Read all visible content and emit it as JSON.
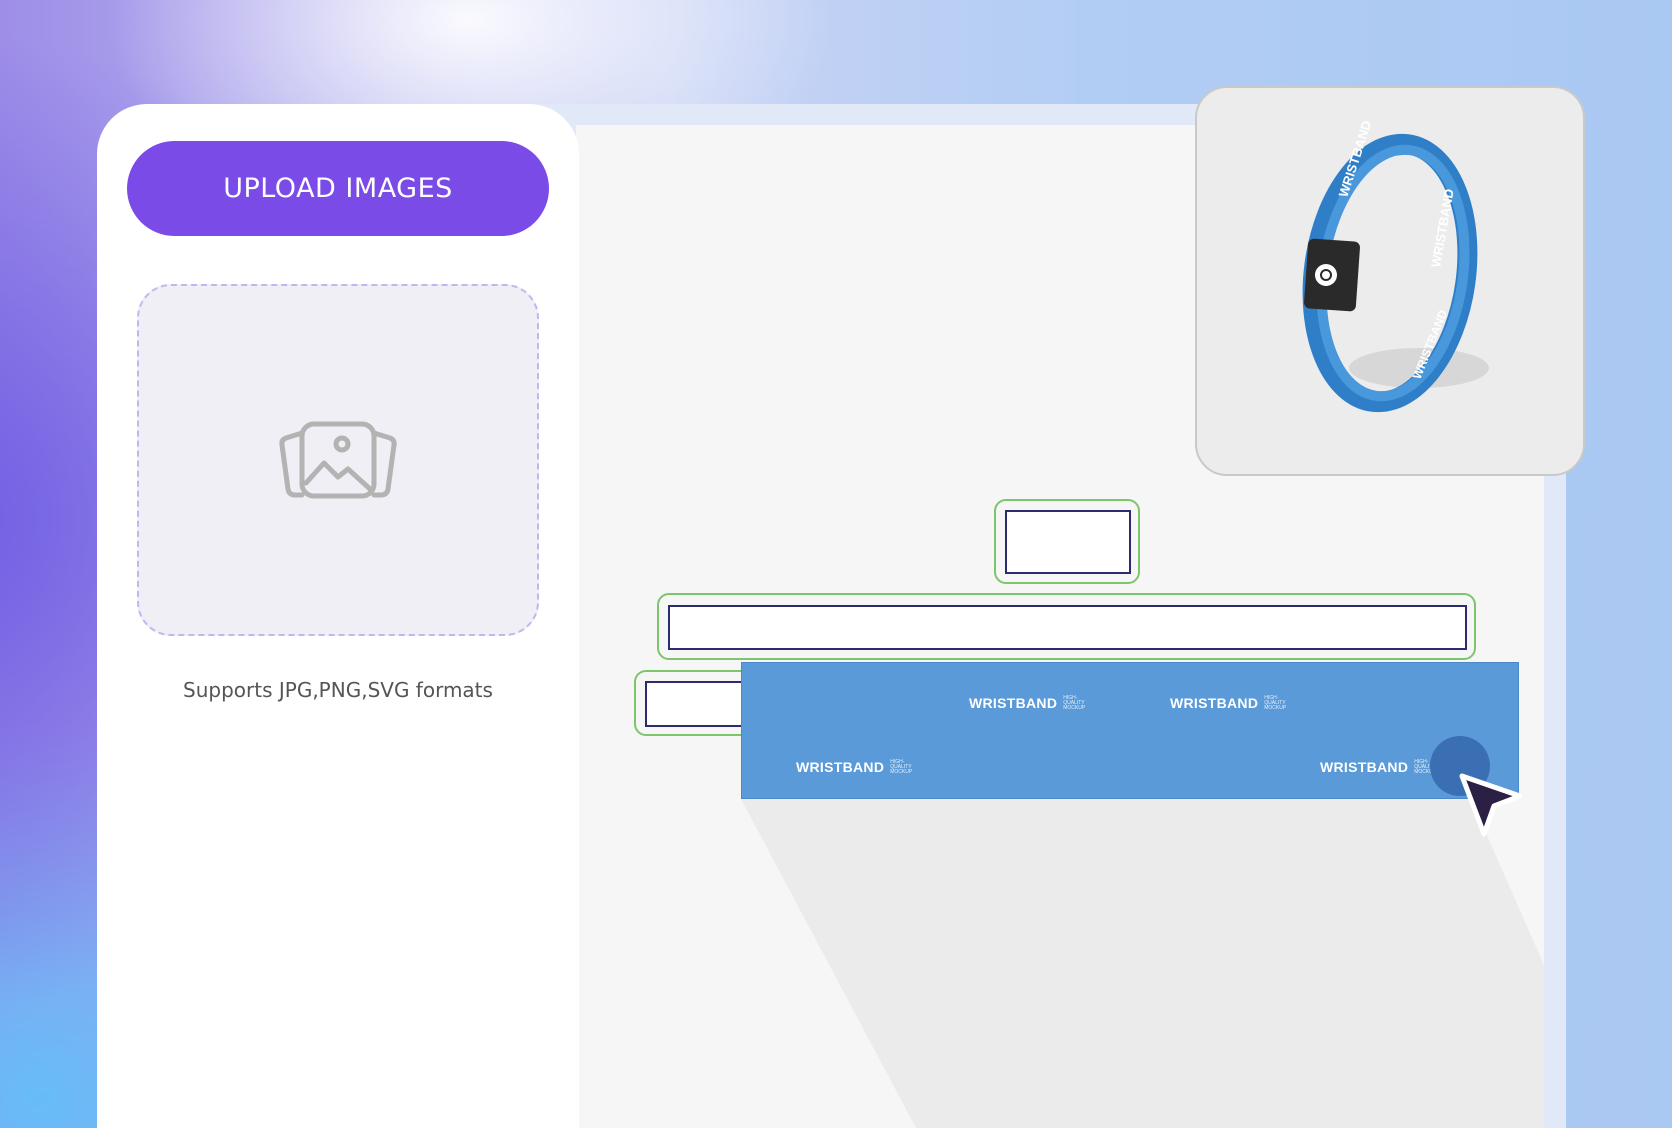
{
  "sidebar": {
    "upload_label": "UPLOAD IMAGES",
    "dropzone_icon": "image-gallery-icon",
    "support_text": "Supports JPG,PNG,SVG formats"
  },
  "preview": {
    "band_text": "WRISTBAND",
    "icon": "wristband-preview"
  },
  "band": {
    "labels": [
      {
        "brand": "WRISTBAND",
        "tag": "HIGH-QUALITY MOCKUP"
      },
      {
        "brand": "WRISTBAND",
        "tag": "HIGH-QUALITY MOCKUP"
      },
      {
        "brand": "WRISTBAND",
        "tag": "HIGH-QUALITY MOCKUP"
      },
      {
        "brand": "WRISTBAND",
        "tag": "HIGH-QUALITY MOCKUP"
      }
    ]
  },
  "colors": {
    "accent": "#7a4be6",
    "field_outline": "#7dc56b",
    "field_inner": "#2e2a6e",
    "band": "#5a9ad8"
  },
  "icons": {
    "cursor": "pointer-arrow-icon",
    "handle": "drag-handle"
  }
}
